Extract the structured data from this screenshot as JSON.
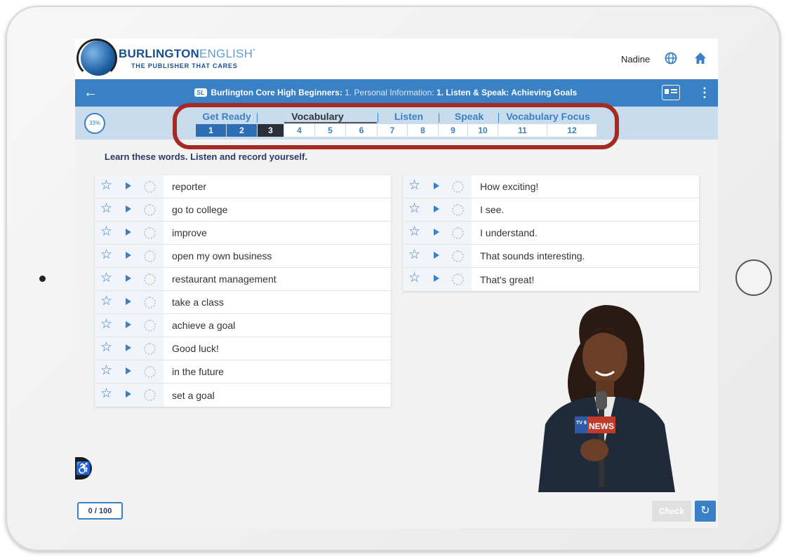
{
  "header": {
    "brand_main": "BURLINGTON",
    "brand_accent": "ENGLISH",
    "brand_mark": "°",
    "tagline": "THE PUBLISHER THAT CARES",
    "user_name": "Nadine",
    "globe_icon": "globe-icon",
    "home_icon": "home-icon"
  },
  "course_bar": {
    "back_icon": "←",
    "badge": "SL",
    "course": "Burlington Core High Beginners:",
    "unit": " 1. Personal Information: ",
    "lesson": "1. Listen & Speak: Achieving Goals",
    "menu_icon": "⋮"
  },
  "nav": {
    "progress": "33%",
    "groups": [
      "Get Ready",
      "Vocabulary",
      "Listen",
      "Speak",
      "Vocabulary Focus"
    ],
    "steps": [
      "1",
      "2",
      "3",
      "4",
      "5",
      "6",
      "7",
      "8",
      "9",
      "10",
      "11",
      "12"
    ]
  },
  "instruction": "Learn these words. Listen and record yourself.",
  "words_left": [
    "reporter",
    "go to college",
    "improve",
    "open my own business",
    "restaurant management",
    "take a class",
    "achieve a goal",
    "Good luck!",
    "in the future",
    "set a goal"
  ],
  "words_right": [
    "How exciting!",
    "I see.",
    "I understand.",
    "That sounds interesting.",
    "That's great!"
  ],
  "photo": {
    "mic_badge_num": "TV 9",
    "mic_badge_text": "NEWS"
  },
  "footer": {
    "score": "0 / 100",
    "check_label": "Check",
    "refresh_icon": "↻"
  },
  "colors": {
    "primary_blue": "#3a80c4",
    "highlight_red": "#a52a22",
    "current_step": "#2b2f3a"
  }
}
